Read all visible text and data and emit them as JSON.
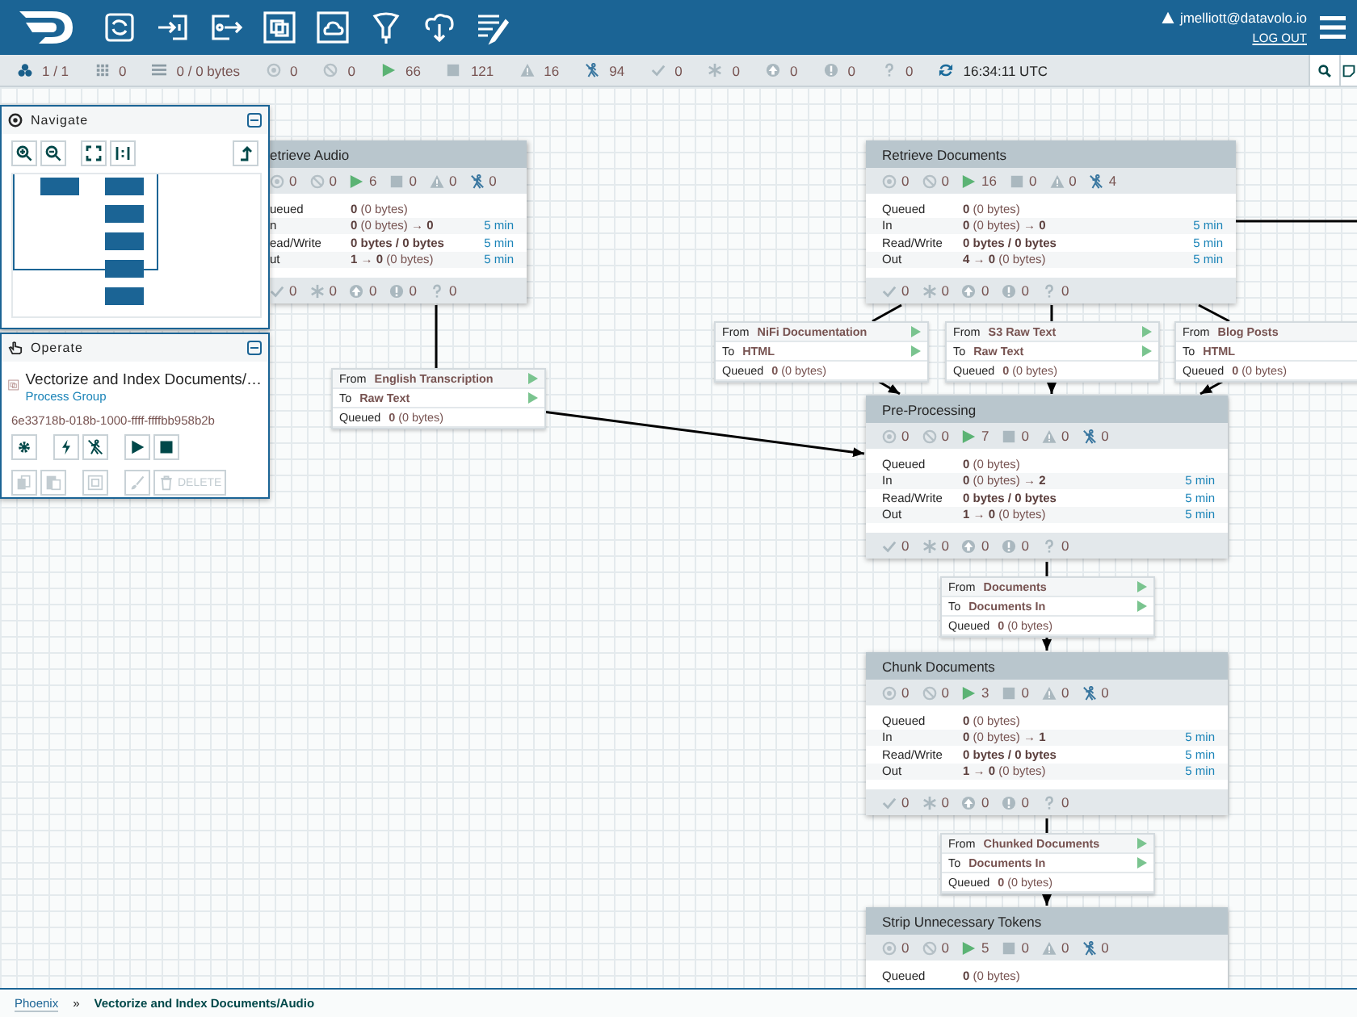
{
  "header": {
    "user": "jmelliott@datavolo.io",
    "logout": "LOG OUT"
  },
  "status_bar": [
    {
      "kind": "cluster",
      "text": "1 / 1"
    },
    {
      "kind": "grid",
      "text": "0"
    },
    {
      "kind": "queue",
      "text": "0 / 0 bytes"
    },
    {
      "kind": "transmitting",
      "text": "0"
    },
    {
      "kind": "not-transmitting",
      "text": "0"
    },
    {
      "kind": "running",
      "text": "66"
    },
    {
      "kind": "stopped",
      "text": "121"
    },
    {
      "kind": "invalid",
      "text": "16"
    },
    {
      "kind": "disabled",
      "text": "94"
    },
    {
      "kind": "up-to-date",
      "text": "0"
    },
    {
      "kind": "modified",
      "text": "0"
    },
    {
      "kind": "stale",
      "text": "0"
    },
    {
      "kind": "modified-stale",
      "text": "0"
    },
    {
      "kind": "sync-failure",
      "text": "0"
    },
    {
      "kind": "refresh",
      "text": "16:34:11 UTC"
    }
  ],
  "navigate": {
    "title": "Navigate"
  },
  "operate": {
    "title": "Operate",
    "name": "Vectorize and Index Documents/…",
    "type": "Process Group",
    "id": "6e33718b-018b-1000-ffff-ffffbb958b2b",
    "buttons": [
      {
        "kind": "configure",
        "disabled": false
      },
      {
        "kind": "enable",
        "disabled": false
      },
      {
        "kind": "disable",
        "disabled": false
      },
      {
        "kind": "start",
        "disabled": false
      },
      {
        "kind": "stop",
        "disabled": false
      },
      {
        "kind": "copy",
        "disabled": true
      },
      {
        "kind": "paste",
        "disabled": true
      },
      {
        "kind": "group",
        "disabled": true
      },
      {
        "kind": "color",
        "disabled": true
      },
      {
        "kind": "delete",
        "disabled": true,
        "label": "DELETE"
      }
    ]
  },
  "process_groups": [
    {
      "title": "etrieve Audio",
      "stats": [
        "0",
        "0",
        "6",
        "0",
        "0",
        "0"
      ],
      "rows": [
        {
          "kind": "queued",
          "label": "ueued",
          "value": "**0** (0 bytes)"
        },
        {
          "kind": "in",
          "label": "n",
          "value": "**0** (0 bytes) → **0**",
          "time": "5 min"
        },
        {
          "kind": "io",
          "label": "ead/Write",
          "value": "0 bytes / 0 bytes",
          "time": "5 min"
        },
        {
          "kind": "out",
          "label": "ut",
          "value": "**1** → **0** (0 bytes)",
          "time": "5 min"
        }
      ],
      "versions": [
        "0",
        "0",
        "0",
        "0",
        "0"
      ]
    },
    {
      "title": "Retrieve Documents",
      "stats": [
        "0",
        "0",
        "16",
        "0",
        "0",
        "4"
      ],
      "rows": [
        {
          "kind": "queued",
          "label": "Queued",
          "value": "**0** (0 bytes)"
        },
        {
          "kind": "in",
          "label": "In",
          "value": "**0** (0 bytes) → **0**",
          "time": "5 min"
        },
        {
          "kind": "io",
          "label": "Read/Write",
          "value": "0 bytes / 0 bytes",
          "time": "5 min"
        },
        {
          "kind": "out",
          "label": "Out",
          "value": "**4** → **0** (0 bytes)",
          "time": "5 min"
        }
      ],
      "versions": [
        "0",
        "0",
        "0",
        "0",
        "0"
      ]
    },
    {
      "title": "Pre-Processing",
      "stats": [
        "0",
        "0",
        "7",
        "0",
        "0",
        "0"
      ],
      "rows": [
        {
          "kind": "queued",
          "label": "Queued",
          "value": "**0** (0 bytes)"
        },
        {
          "kind": "in",
          "label": "In",
          "value": "**0** (0 bytes) → **2**",
          "time": "5 min"
        },
        {
          "kind": "io",
          "label": "Read/Write",
          "value": "0 bytes / 0 bytes",
          "time": "5 min"
        },
        {
          "kind": "out",
          "label": "Out",
          "value": "**1** → **0** (0 bytes)",
          "time": "5 min"
        }
      ],
      "versions": [
        "0",
        "0",
        "0",
        "0",
        "0"
      ]
    },
    {
      "title": "Chunk Documents",
      "stats": [
        "0",
        "0",
        "3",
        "0",
        "0",
        "0"
      ],
      "rows": [
        {
          "kind": "queued",
          "label": "Queued",
          "value": "**0** (0 bytes)"
        },
        {
          "kind": "in",
          "label": "In",
          "value": "**0** (0 bytes) → **1**",
          "time": "5 min"
        },
        {
          "kind": "io",
          "label": "Read/Write",
          "value": "0 bytes / 0 bytes",
          "time": "5 min"
        },
        {
          "kind": "out",
          "label": "Out",
          "value": "**1** → **0** (0 bytes)",
          "time": "5 min"
        }
      ],
      "versions": [
        "0",
        "0",
        "0",
        "0",
        "0"
      ]
    },
    {
      "title": "Strip Unnecessary Tokens",
      "stats": [
        "0",
        "0",
        "5",
        "0",
        "0",
        "0"
      ],
      "rows": [
        {
          "kind": "queued",
          "label": "Queued",
          "value": "**0** (0 bytes)"
        }
      ]
    }
  ],
  "connections": [
    {
      "rows": [
        {
          "label": "From",
          "value": "NiFi Documentation",
          "arrow": true
        },
        {
          "label": "To",
          "value": "HTML",
          "arrow": true
        }
      ],
      "queued_label": "Queued",
      "queued": "**0** (0 bytes)"
    },
    {
      "rows": [
        {
          "label": "From",
          "value": "S3 Raw Text",
          "arrow": true
        },
        {
          "label": "To",
          "value": "Raw Text",
          "arrow": true
        }
      ],
      "queued_label": "Queued",
      "queued": "**0** (0 bytes)"
    },
    {
      "rows": [
        {
          "label": "From",
          "value": "Blog Posts",
          "arrow": false
        },
        {
          "label": "To",
          "value": "HTML",
          "arrow": false
        }
      ],
      "queued_label": "Queued",
      "queued": "**0** (0 bytes)"
    },
    {
      "rows": [
        {
          "label": "From",
          "value": "English Transcription",
          "arrow": true
        },
        {
          "label": "To",
          "value": "Raw Text",
          "arrow": true
        }
      ],
      "queued_label": "Queued",
      "queued": "**0** (0 bytes)"
    },
    {
      "rows": [
        {
          "label": "From",
          "value": "Documents",
          "arrow": true
        },
        {
          "label": "To",
          "value": "Documents In",
          "arrow": true
        }
      ],
      "queued_label": "Queued",
      "queued": "**0** (0 bytes)"
    },
    {
      "rows": [
        {
          "label": "From",
          "value": "Chunked Documents",
          "arrow": true
        },
        {
          "label": "To",
          "value": "Documents In",
          "arrow": true
        }
      ],
      "queued_label": "Queued",
      "queued": "**0** (0 bytes)"
    }
  ],
  "breadcrumbs": [
    {
      "text": "Phoenix",
      "link": true
    },
    {
      "text": "Vectorize and Index Documents/Audio",
      "link": false
    }
  ],
  "breadcrumb_separator": "»"
}
